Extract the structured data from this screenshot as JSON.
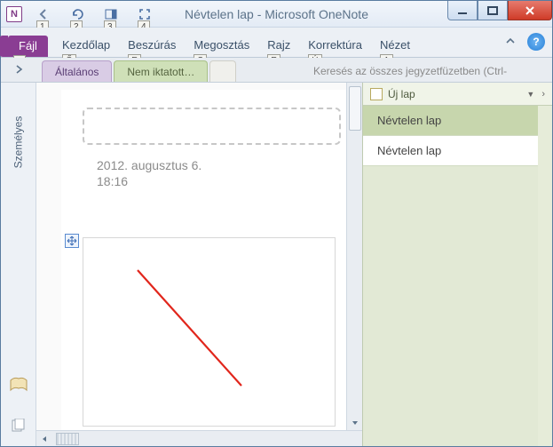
{
  "window": {
    "title": "Névtelen lap  -  Microsoft OneNote"
  },
  "qat": {
    "k1": "1",
    "k2": "2",
    "k3": "3",
    "k4": "4"
  },
  "ribbon": {
    "file": "Fájl",
    "file_key": "F",
    "tabs": [
      {
        "label": "Kezdőlap",
        "key": "Ő"
      },
      {
        "label": "Beszúrás",
        "key": "E"
      },
      {
        "label": "Megosztás",
        "key": "S"
      },
      {
        "label": "Rajz",
        "key": "R"
      },
      {
        "label": "Korrektúra",
        "key": "Ú"
      },
      {
        "label": "Nézet",
        "key": "A"
      }
    ],
    "help": "?"
  },
  "sections": {
    "purple": "Általános",
    "green": "Nem iktatott…"
  },
  "search": {
    "placeholder": "Keresés az összes jegyzetfüzetben (Ctrl-"
  },
  "sidebar": {
    "label": "Személyes"
  },
  "page": {
    "date": "2012. augusztus 6.",
    "time": "18:16"
  },
  "pagelist": {
    "new_label": "Új lap",
    "items": [
      {
        "label": "Névtelen lap"
      },
      {
        "label": "Névtelen lap"
      }
    ]
  }
}
